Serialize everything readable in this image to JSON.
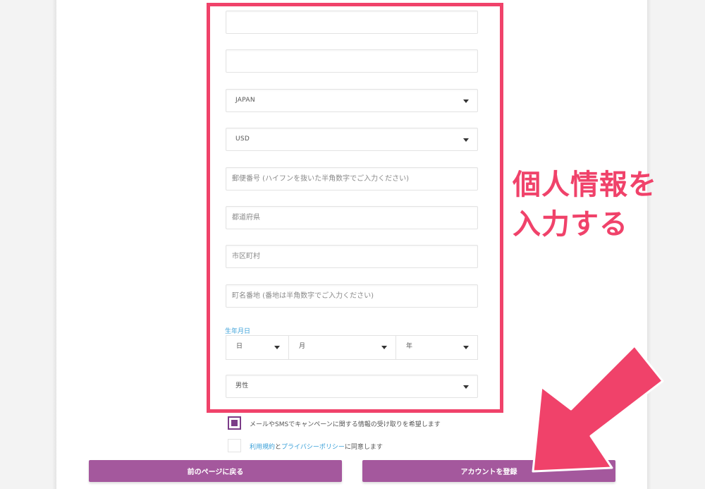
{
  "form": {
    "field1": {
      "value": "",
      "placeholder": ""
    },
    "field2": {
      "value": "",
      "placeholder": ""
    },
    "country": {
      "selected": "JAPAN"
    },
    "currency": {
      "selected": "USD"
    },
    "postal_code": {
      "placeholder": "郵便番号 (ハイフンを抜いた半角数字でご入力ください)"
    },
    "prefecture": {
      "placeholder": "都道府県"
    },
    "city": {
      "placeholder": "市区町村"
    },
    "street": {
      "placeholder": "町名番地 (番地は半角数字でご入力ください)"
    },
    "dob": {
      "label": "生年月日",
      "day": "日",
      "month": "月",
      "year": "年"
    },
    "gender": {
      "selected": "男性"
    }
  },
  "consent": {
    "marketing_label": "メールやSMSでキャンペーンに関する情報の受け取りを希望します",
    "marketing_checked": true,
    "terms_link": "利用規約",
    "and": "と",
    "privacy_link": "プライバシーポリシー",
    "terms_suffix": "に同意します",
    "terms_checked": false
  },
  "buttons": {
    "back": "前のページに戻る",
    "register": "アカウントを登録"
  },
  "annotation": {
    "line1": "個人情報を",
    "line2": "入力する"
  },
  "colors": {
    "highlight": "#f0426a",
    "button": "#a4589d",
    "checkbox": "#7b3c88",
    "link": "#3aa0d8"
  }
}
